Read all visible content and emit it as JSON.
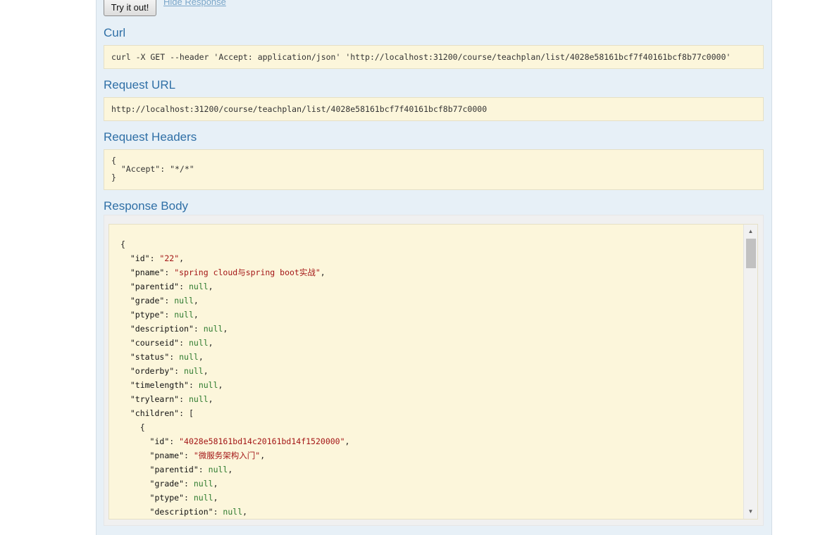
{
  "buttons": {
    "try_it_out": "Try it out!",
    "hide_response": "Hide Response"
  },
  "sections": {
    "curl": {
      "title": "Curl",
      "command": "curl -X GET --header 'Accept: application/json' 'http://localhost:31200/course/teachplan/list/4028e58161bcf7f40161bcf8b77c0000'"
    },
    "request_url": {
      "title": "Request URL",
      "url": "http://localhost:31200/course/teachplan/list/4028e58161bcf7f40161bcf8b77c0000"
    },
    "request_headers": {
      "title": "Request Headers",
      "lines": [
        "{",
        "  \"Accept\": \"*/*\"",
        "}"
      ]
    },
    "response_body": {
      "title": "Response Body",
      "lines": [
        {
          "indent": "",
          "open": "{"
        },
        {
          "indent": "  ",
          "key": "id",
          "str": "22",
          "end": ","
        },
        {
          "indent": "  ",
          "key": "pname",
          "str": "spring cloud与spring boot实战",
          "end": ","
        },
        {
          "indent": "  ",
          "key": "parentid",
          "val": "null",
          "end": ","
        },
        {
          "indent": "  ",
          "key": "grade",
          "val": "null",
          "end": ","
        },
        {
          "indent": "  ",
          "key": "ptype",
          "val": "null",
          "end": ","
        },
        {
          "indent": "  ",
          "key": "description",
          "val": "null",
          "end": ","
        },
        {
          "indent": "  ",
          "key": "courseid",
          "val": "null",
          "end": ","
        },
        {
          "indent": "  ",
          "key": "status",
          "val": "null",
          "end": ","
        },
        {
          "indent": "  ",
          "key": "orderby",
          "val": "null",
          "end": ","
        },
        {
          "indent": "  ",
          "key": "timelength",
          "val": "null",
          "end": ","
        },
        {
          "indent": "  ",
          "key": "trylearn",
          "val": "null",
          "end": ","
        },
        {
          "indent": "  ",
          "key": "children",
          "open": "["
        },
        {
          "indent": "    ",
          "open": "{"
        },
        {
          "indent": "      ",
          "key": "id",
          "str": "4028e58161bd14c20161bd14f1520000",
          "end": ","
        },
        {
          "indent": "      ",
          "key": "pname",
          "str": "微服务架构入门",
          "end": ","
        },
        {
          "indent": "      ",
          "key": "parentid",
          "val": "null",
          "end": ","
        },
        {
          "indent": "      ",
          "key": "grade",
          "val": "null",
          "end": ","
        },
        {
          "indent": "      ",
          "key": "ptype",
          "val": "null",
          "end": ","
        },
        {
          "indent": "      ",
          "key": "description",
          "val": "null",
          "end": ","
        }
      ]
    }
  },
  "scrollbar": {
    "up_arrow": "▲",
    "down_arrow": "▼"
  }
}
